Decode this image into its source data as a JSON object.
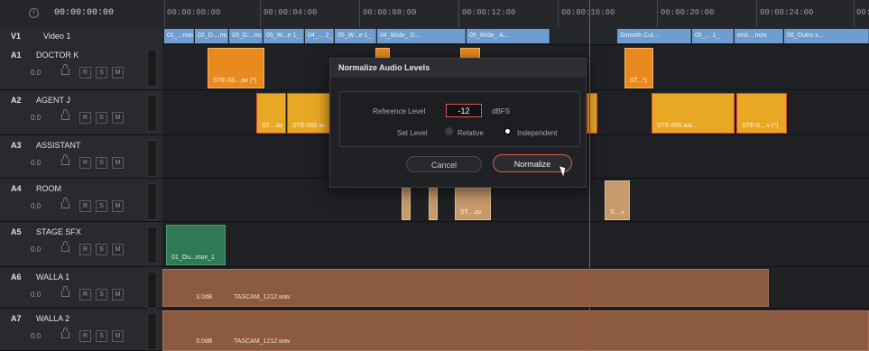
{
  "timeline": {
    "timecode": "00:00:00:00",
    "ruler_labels": [
      "00:00:00:00",
      "00:00:04:00",
      "00:00:08:00",
      "00:00:12:00",
      "00:00:16:00",
      "00:00:20:00",
      "00:00:24:00",
      "00:0"
    ]
  },
  "tracks": {
    "video": {
      "id": "V1",
      "name": "Video 1"
    },
    "audio": [
      {
        "id": "A1",
        "name": "DOCTOR K",
        "vol": "0.0"
      },
      {
        "id": "A2",
        "name": "AGENT J",
        "vol": "0.0"
      },
      {
        "id": "A3",
        "name": "ASSISTANT",
        "vol": "0.0"
      },
      {
        "id": "A4",
        "name": "ROOM",
        "vol": "0.0"
      },
      {
        "id": "A5",
        "name": "STAGE SFX",
        "vol": "0.0"
      },
      {
        "id": "A6",
        "name": "WALLA 1",
        "vol": "0.0"
      },
      {
        "id": "A7",
        "name": "WALLA 2",
        "vol": "0.0"
      }
    ],
    "buttons": {
      "r": "R",
      "s": "S",
      "m": "M"
    }
  },
  "video_clips": [
    "01_...mov",
    "02_D....mov",
    "03_D....mov",
    "05_W...e 1_",
    "04_... 2_",
    "05_W...e 1_",
    "04_Wide_ D...",
    "05_Wide_ A...",
    "Smooth Cut...",
    "05_... 1_",
    "end....mov",
    "06_Outro s..."
  ],
  "audio_clips": {
    "a1_left": "STE-03....av (*)",
    "a1_right": "ST...*)",
    "a2_1": "ST....av",
    "a2_2": "STE-055.w...",
    "a2_3": "STE-055.wa...",
    "a2_4": "STE-0....v (*)",
    "a4_1": "ST....av",
    "a4_2": "S....v",
    "a5": "01_Ou...mov_1",
    "walla1_gain": "3.0dB",
    "walla1_file": "TASCAM_1212.wav",
    "walla2_gain": "3.0dB",
    "walla2_file": "TASCAM_1212.wav"
  },
  "dialog": {
    "title": "Normalize Audio Levels",
    "reference_label": "Reference Level",
    "reference_value": "-12",
    "reference_unit": "dBFS",
    "set_level_label": "Set Level",
    "relative_label": "Relative",
    "independent_label": "Independent",
    "cancel": "Cancel",
    "normalize": "Normalize"
  }
}
